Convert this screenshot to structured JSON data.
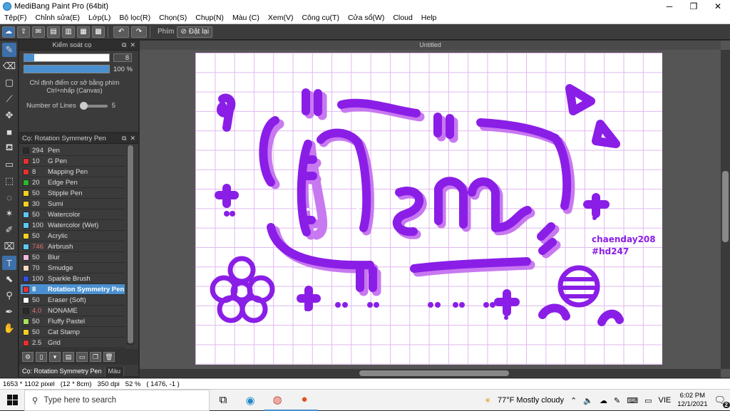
{
  "window": {
    "title": "MediBang Paint Pro (64bit)"
  },
  "menu": [
    "Tệp(F)",
    "Chỉnh sửa(E)",
    "Lớp(L)",
    "Bộ lọc(R)",
    "Chọn(S)",
    "Chụp(N)",
    "Màu (C)",
    "Xem(V)",
    "Công cụ(T)",
    "Cửa sổ(W)",
    "Cloud",
    "Help"
  ],
  "toolbar": {
    "phim_label": "Phím",
    "reset_label": "Đặt lại"
  },
  "brush_control": {
    "title": "Kiểm soát cọ",
    "size_value": "8",
    "opacity_value": "100 %",
    "opacity_fraction": 1.0,
    "size_fraction": 0.12,
    "hint_line1": "Chỉ định điểm cơ sở bằng phím",
    "hint_line2": "Ctrl+nhấp (Canvas)",
    "lines_label": "Number of Lines",
    "lines_value": "5"
  },
  "brush_panel": {
    "title": "Cọ: Rotation Symmetry Pen",
    "brushes": [
      {
        "size": "294",
        "name": "Pen",
        "color": "#2a2a2a"
      },
      {
        "size": "10",
        "name": "G Pen",
        "color": "#e53030"
      },
      {
        "size": "8",
        "name": "Mapping Pen",
        "color": "#e53030"
      },
      {
        "size": "20",
        "name": "Edge Pen",
        "color": "#2db82d"
      },
      {
        "size": "50",
        "name": "Stipple Pen",
        "color": "#f0d020"
      },
      {
        "size": "30",
        "name": "Sumi",
        "color": "#f0d020"
      },
      {
        "size": "50",
        "name": "Watercolor",
        "color": "#5bc8f0"
      },
      {
        "size": "100",
        "name": "Watercolor (Wet)",
        "color": "#5bc8f0"
      },
      {
        "size": "50",
        "name": "Acrylic",
        "color": "#f0d020"
      },
      {
        "size": "746",
        "name": "Airbrush",
        "color": "#5bc8f0"
      },
      {
        "size": "50",
        "name": "Blur",
        "color": "#f0b8d8"
      },
      {
        "size": "70",
        "name": "Smudge",
        "color": "#f5d8c0"
      },
      {
        "size": "100",
        "name": "Sparkle Brush",
        "color": "#3050e0"
      },
      {
        "size": "8",
        "name": "Rotation Symmetry Pen",
        "color": "#e53030"
      },
      {
        "size": "50",
        "name": "Eraser (Soft)",
        "color": "#ffffff"
      },
      {
        "size": "4.0",
        "name": "NONAME",
        "color": "#2a2a2a"
      },
      {
        "size": "50",
        "name": "Fluffy Pastel",
        "color": "#a8e060"
      },
      {
        "size": "50",
        "name": "Cat Stamp",
        "color": "#f0d020"
      },
      {
        "size": "2.5",
        "name": "Grid",
        "color": "#e53030"
      }
    ]
  },
  "bottom_tabs": [
    "Cọ: Rotation Symmetry Pen",
    "Màu"
  ],
  "document": {
    "tab": "Untitled",
    "credit_line1": "chaenday208",
    "credit_line2": "#hd247"
  },
  "status": {
    "size": "1653 * 1102 pixel",
    "cm": "(12 * 8cm)",
    "dpi": "350 dpi",
    "zoom": "52 %",
    "coords": "( 1476, -1 )"
  },
  "taskbar": {
    "search_placeholder": "Type here to search",
    "weather": "77°F  Mostly cloudy",
    "lang": "VIE",
    "time": "6:02 PM",
    "date": "12/1/2021",
    "notif_count": "2"
  },
  "colors": {
    "accent": "#4a90d0",
    "art_dark": "#8a1ee6",
    "art_light": "#c878f0"
  }
}
